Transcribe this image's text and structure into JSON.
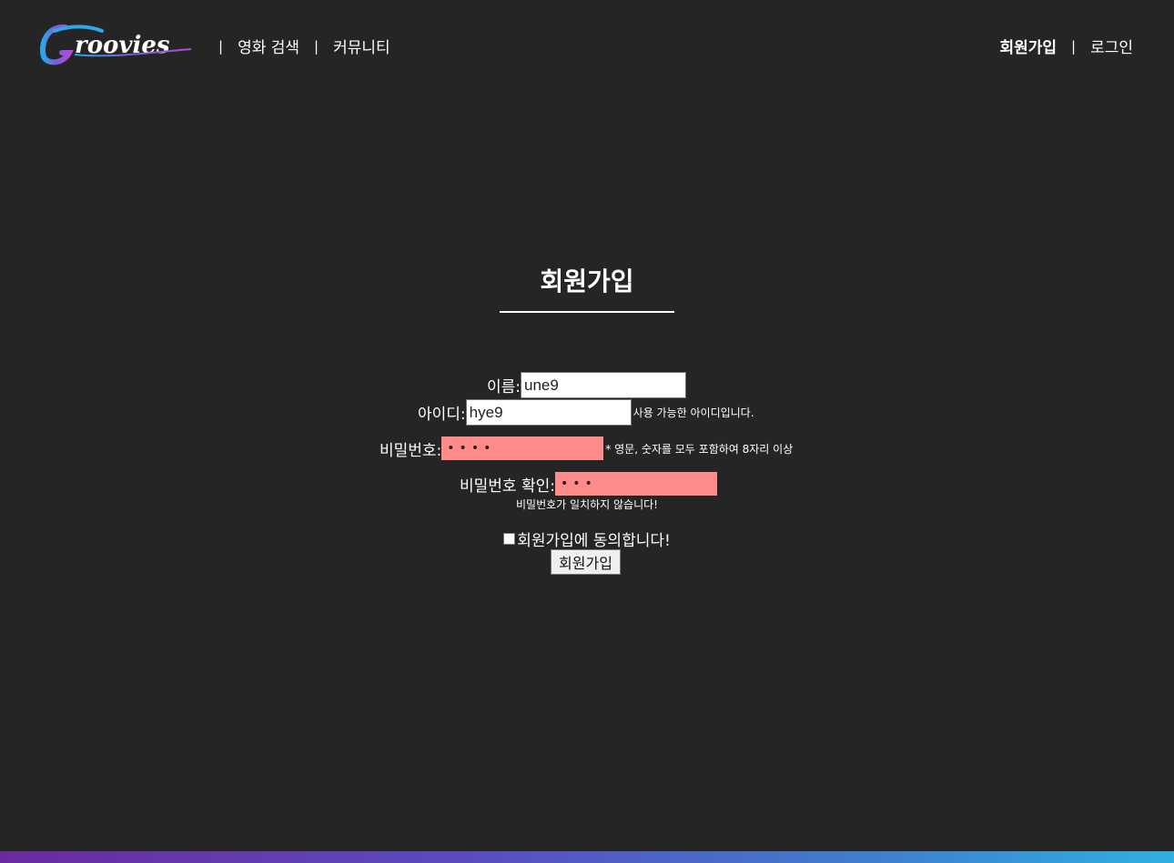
{
  "header": {
    "logo_alt": "Groovies",
    "nav_left": [
      {
        "label": "영화 검색"
      },
      {
        "label": "커뮤니티"
      }
    ],
    "nav_right": [
      {
        "label": "회원가입"
      },
      {
        "label": "로그인"
      }
    ],
    "separator": "|"
  },
  "main": {
    "title": "회원가입",
    "form": {
      "name": {
        "label": "이름:",
        "value": "une9"
      },
      "id": {
        "label": "아이디:",
        "value": "hye9",
        "hint": "사용 가능한 아이디입니다."
      },
      "password": {
        "label": "비밀번호:",
        "masked": "••••",
        "hint": "* 영문, 숫자를 모두 포함하여 8자리 이상"
      },
      "password_confirm": {
        "label": "비밀번호 확인:",
        "masked": "•••",
        "error": "비밀번호가 일치하지 않습니다!"
      },
      "agree": {
        "label": "회원가입에 동의합니다!"
      },
      "submit_label": "회원가입"
    }
  },
  "colors": {
    "background": "#252525",
    "password_field": "#ff8a8a",
    "text": "#ffffff"
  }
}
